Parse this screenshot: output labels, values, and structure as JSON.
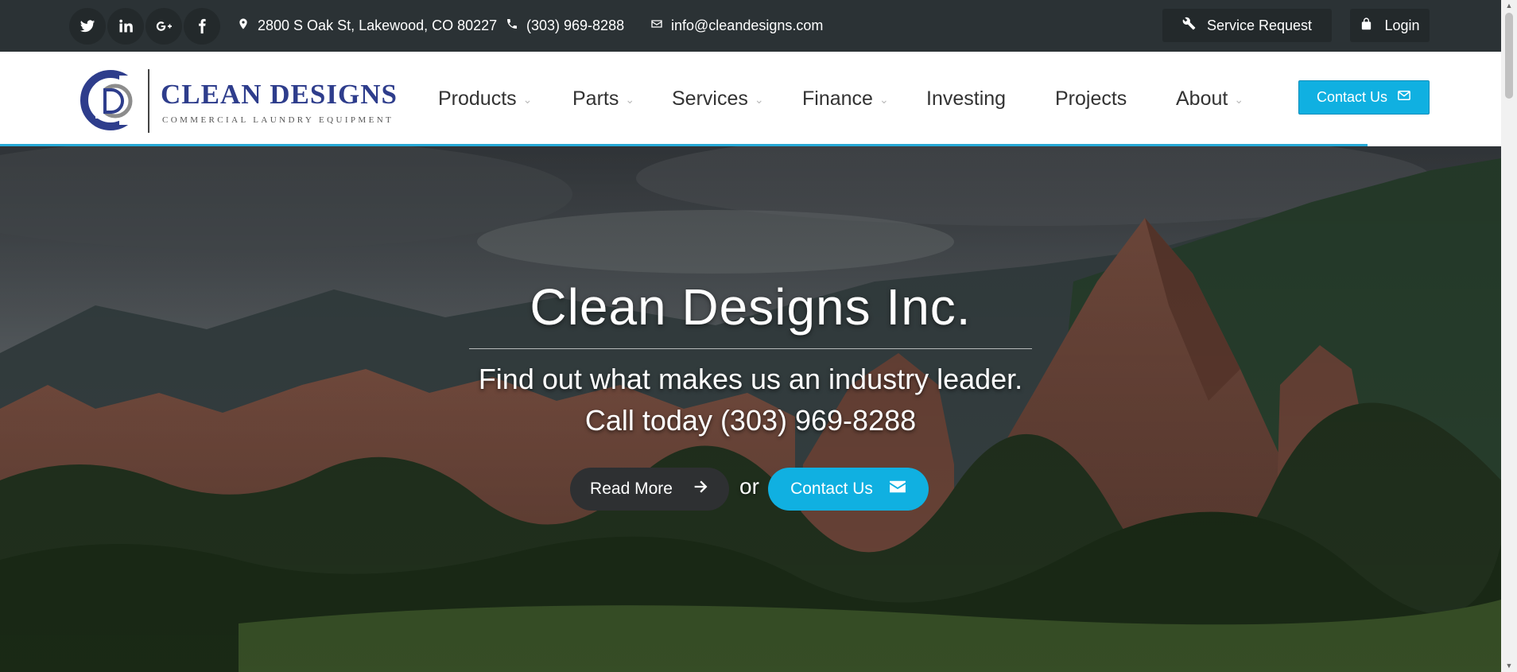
{
  "topbar": {
    "social": [
      {
        "name": "twitter-icon"
      },
      {
        "name": "linkedin-icon"
      },
      {
        "name": "google-plus-icon"
      },
      {
        "name": "facebook-icon"
      }
    ],
    "address": "2800 S Oak St, Lakewood, CO 80227",
    "phone": "(303) 969-8288",
    "email": "info@cleandesigns.com",
    "service_request": "Service Request",
    "login": "Login"
  },
  "header": {
    "logo_name": "CLEAN DESIGNS",
    "logo_tagline": "COMMERCIAL LAUNDRY EQUIPMENT",
    "nav": [
      {
        "label": "Products",
        "dropdown": true
      },
      {
        "label": "Parts",
        "dropdown": true
      },
      {
        "label": "Services",
        "dropdown": true
      },
      {
        "label": "Finance",
        "dropdown": true
      },
      {
        "label": "Investing",
        "dropdown": false
      },
      {
        "label": "Projects",
        "dropdown": false
      },
      {
        "label": "About",
        "dropdown": true
      }
    ],
    "contact_label": "Contact Us"
  },
  "hero": {
    "title": "Clean Designs Inc.",
    "subtitle": "Find out what makes us an industry leader.",
    "call_line": "Call today (303) 969-8288",
    "read_more": "Read More",
    "or_text": "or",
    "contact_label": "Contact Us"
  },
  "colors": {
    "topbar": "#2b3235",
    "accent": "#10b0e1",
    "brand_navy": "#2e3d8c"
  }
}
